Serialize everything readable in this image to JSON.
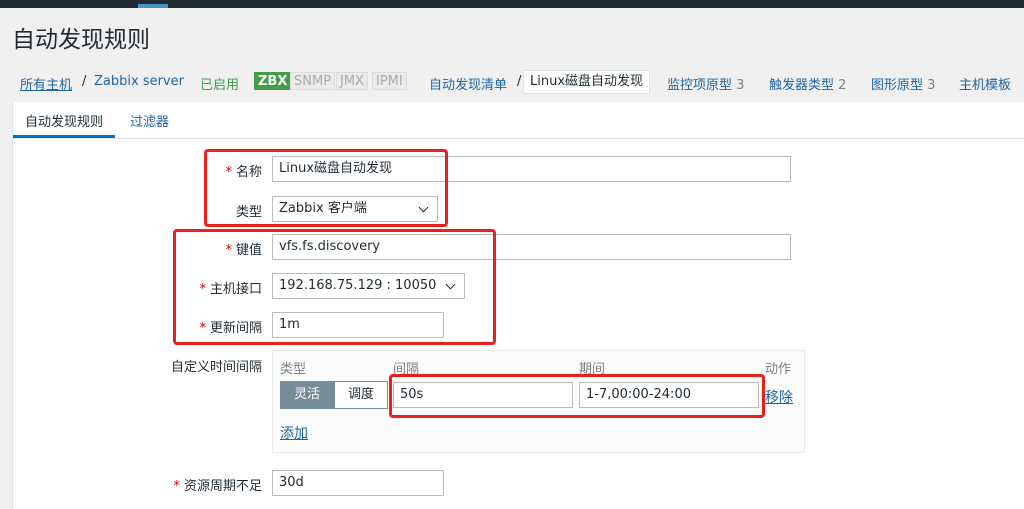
{
  "page": {
    "title": "自动发现规则"
  },
  "breadcrumb": {
    "all_hosts": "所有主机",
    "sep1": "/",
    "host": "Zabbix server",
    "status": "已启用",
    "tags": [
      "ZBX",
      "SNMP",
      "JMX",
      "IPMI"
    ],
    "discovery_list": "自动发现清单",
    "sep2": "/",
    "current": "Linux磁盘自动发现",
    "item_proto": {
      "label": "监控项原型",
      "count": "3"
    },
    "trigger_types": {
      "label": "触发器类型",
      "count": "2"
    },
    "graph_proto": {
      "label": "图形原型",
      "count": "3"
    },
    "host_template": {
      "label": "主机模板"
    }
  },
  "tabs": {
    "rule": "自动发现规则",
    "filter": "过滤器"
  },
  "form": {
    "required_mark": "*",
    "name": {
      "label": "名称",
      "value": "Linux磁盘自动发现"
    },
    "type": {
      "label": "类型",
      "value": "Zabbix 客户端"
    },
    "key": {
      "label": "键值",
      "value": "vfs.fs.discovery"
    },
    "interface": {
      "label": "主机接口",
      "value": "192.168.75.129 : 10050"
    },
    "update_interval": {
      "label": "更新间隔",
      "value": "1m"
    },
    "custom_intervals": {
      "label": "自定义时间间隔",
      "headers": {
        "type": "类型",
        "interval": "间隔",
        "period": "期间",
        "action": "动作"
      },
      "row": {
        "flexible": "灵活",
        "scheduling": "调度",
        "interval": "50s",
        "period": "1-7,00:00-24:00",
        "remove": "移除"
      },
      "add": "添加"
    },
    "lost_period": {
      "label": "资源周期不足",
      "value": "30d"
    }
  },
  "colors": {
    "link": "#1f65a6",
    "enabled": "#429e47",
    "required": "#d40000",
    "highlight": "#e8211d",
    "tab_accent": "#0275b8"
  }
}
